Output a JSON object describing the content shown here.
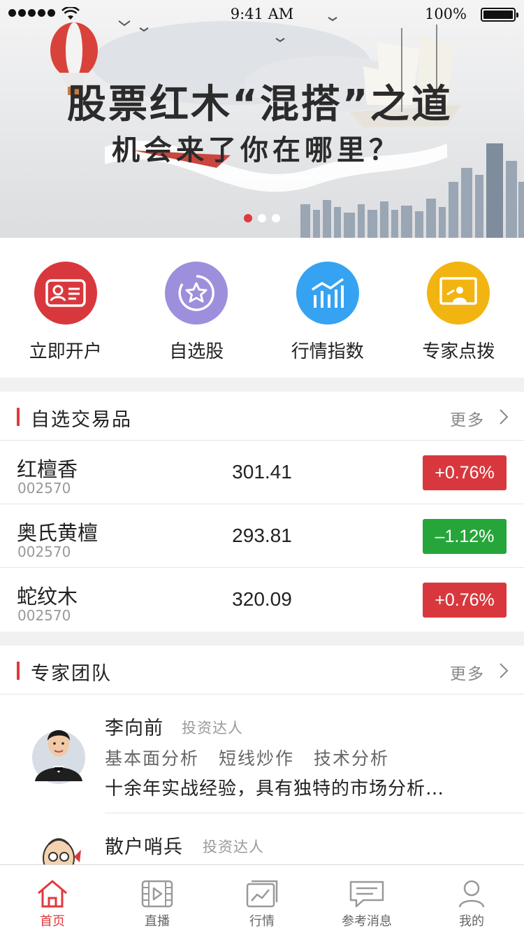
{
  "status_bar": {
    "time": "9:41 AM",
    "battery": "100%"
  },
  "banner": {
    "title": "股票红木“混搭”之道",
    "subtitle": "机会来了你在哪里？",
    "page_count": 3,
    "active_page": 1
  },
  "quick_entries": [
    {
      "label": "立即开户",
      "icon": "id-card-icon",
      "color": "#d8383d"
    },
    {
      "label": "自选股",
      "icon": "star-icon",
      "color": "#9d8fdc"
    },
    {
      "label": "行情指数",
      "icon": "bar-chart-icon",
      "color": "#35a3f2"
    },
    {
      "label": "专家点拨",
      "icon": "presentation-icon",
      "color": "#f2b410"
    }
  ],
  "trades": {
    "title": "自选交易品",
    "more": "更多",
    "items": [
      {
        "name": "红檀香",
        "code": "002570",
        "price": "301.41",
        "change": "+0.76%",
        "color": "#d8383d"
      },
      {
        "name": "奥氏黄檀",
        "code": "002570",
        "price": "293.81",
        "change": "–1.12%",
        "color": "#26a63a"
      },
      {
        "name": "蛇纹木",
        "code": "002570",
        "price": "320.09",
        "change": "+0.76%",
        "color": "#d8383d"
      }
    ]
  },
  "experts": {
    "title": "专家团队",
    "more": "更多",
    "items": [
      {
        "name": "李向前",
        "role": "投资达人",
        "tags": [
          "基本面分析",
          "短线炒作",
          "技术分析"
        ],
        "desc": "十余年实战经验，具有独特的市场分析…"
      },
      {
        "name": "散户哨兵",
        "role": "投资达人"
      }
    ]
  },
  "tabs": [
    {
      "label": "首页",
      "icon": "home-icon",
      "active": true
    },
    {
      "label": "直播",
      "icon": "video-icon",
      "active": false
    },
    {
      "label": "行情",
      "icon": "market-chart-icon",
      "active": false
    },
    {
      "label": "参考消息",
      "icon": "message-icon",
      "active": false
    },
    {
      "label": "我的",
      "icon": "user-icon",
      "active": false
    }
  ],
  "colors": {
    "accent": "#e0393e",
    "rise": "#d8383d",
    "fall": "#26a63a"
  }
}
